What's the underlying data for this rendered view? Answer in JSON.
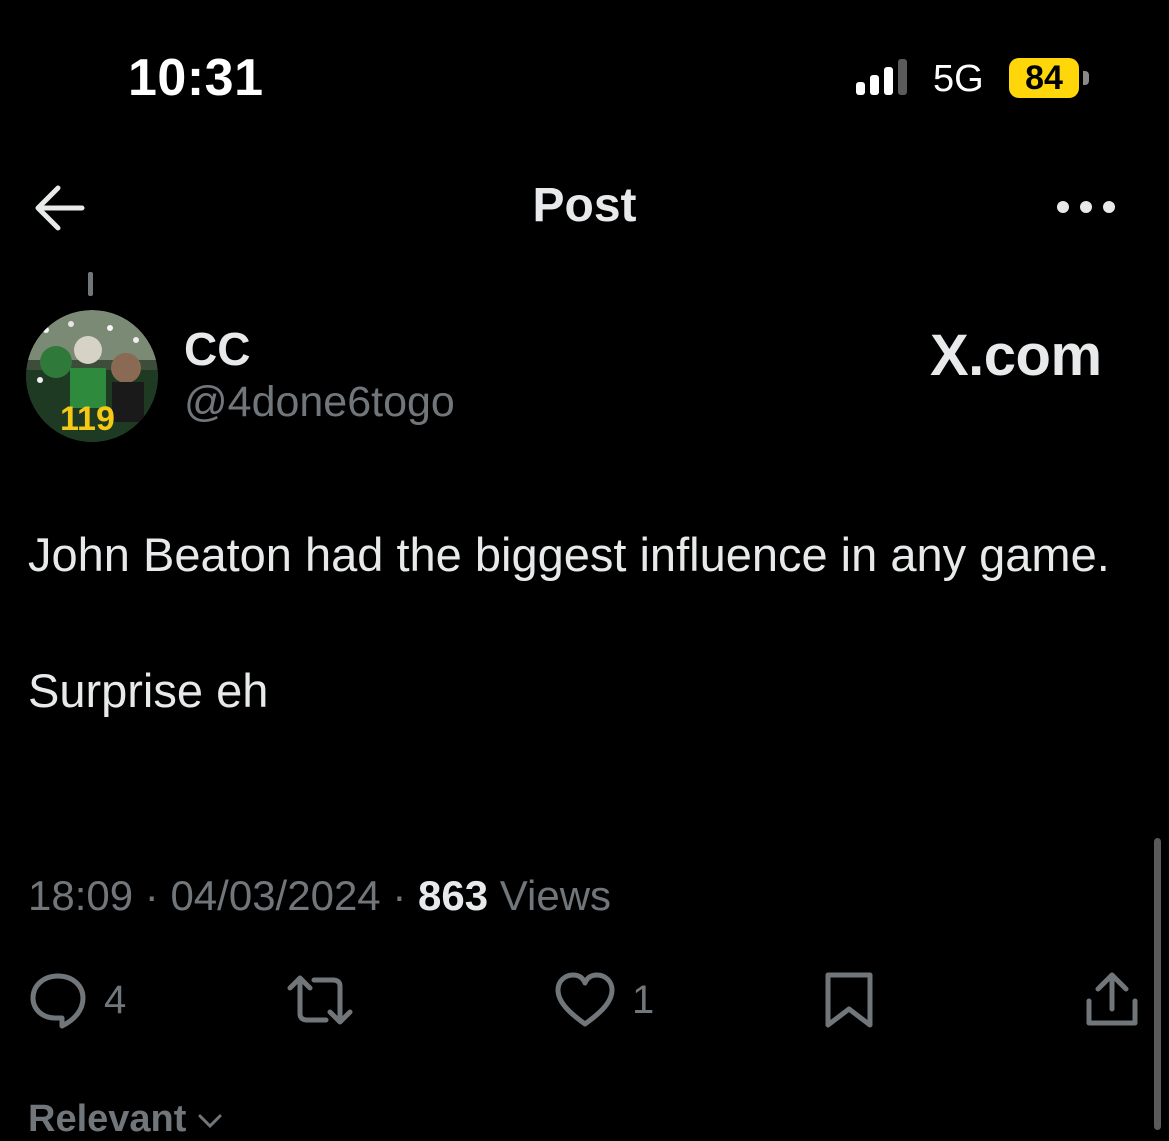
{
  "status_bar": {
    "time": "10:31",
    "network": "5G",
    "battery": "84",
    "battery_color": "#ffd60a"
  },
  "header": {
    "title": "Post",
    "back_icon": "arrow-left-icon",
    "more_icon": "more-horizontal-icon"
  },
  "post": {
    "author": {
      "name": "CC",
      "handle": "@4done6togo",
      "avatar_badge": "119"
    },
    "source_label": "X.com",
    "text": [
      "John Beaton had the biggest influence in any game.",
      "Surprise eh"
    ],
    "meta": {
      "time": "18:09",
      "date": "04/03/2024",
      "separator": "·",
      "views_count": "863",
      "views_label": "Views"
    },
    "actions": {
      "replies": "4",
      "reposts": "",
      "likes": "1"
    }
  },
  "sort": {
    "label": "Relevant"
  },
  "colors": {
    "background": "#000000",
    "primary_text": "#e7e9ea",
    "secondary_text": "#71767b"
  }
}
